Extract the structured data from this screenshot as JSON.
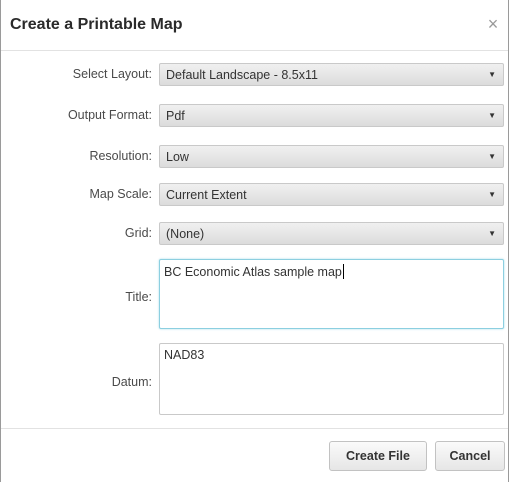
{
  "dialog": {
    "title": "Create a Printable Map",
    "close_label": "×"
  },
  "form": {
    "layout": {
      "label": "Select Layout:",
      "value": "Default Landscape - 8.5x11"
    },
    "format": {
      "label": "Output Format:",
      "value": "Pdf"
    },
    "resolution": {
      "label": "Resolution:",
      "value": "Low"
    },
    "scale": {
      "label": "Map Scale:",
      "value": "Current Extent"
    },
    "grid": {
      "label": "Grid:",
      "value": "(None)"
    },
    "title": {
      "label": "Title:",
      "value": "BC Economic Atlas sample map"
    },
    "datum": {
      "label": "Datum:",
      "value": "NAD83"
    },
    "dropdown_arrow": "▼"
  },
  "footer": {
    "create_label": "Create File",
    "cancel_label": "Cancel"
  }
}
